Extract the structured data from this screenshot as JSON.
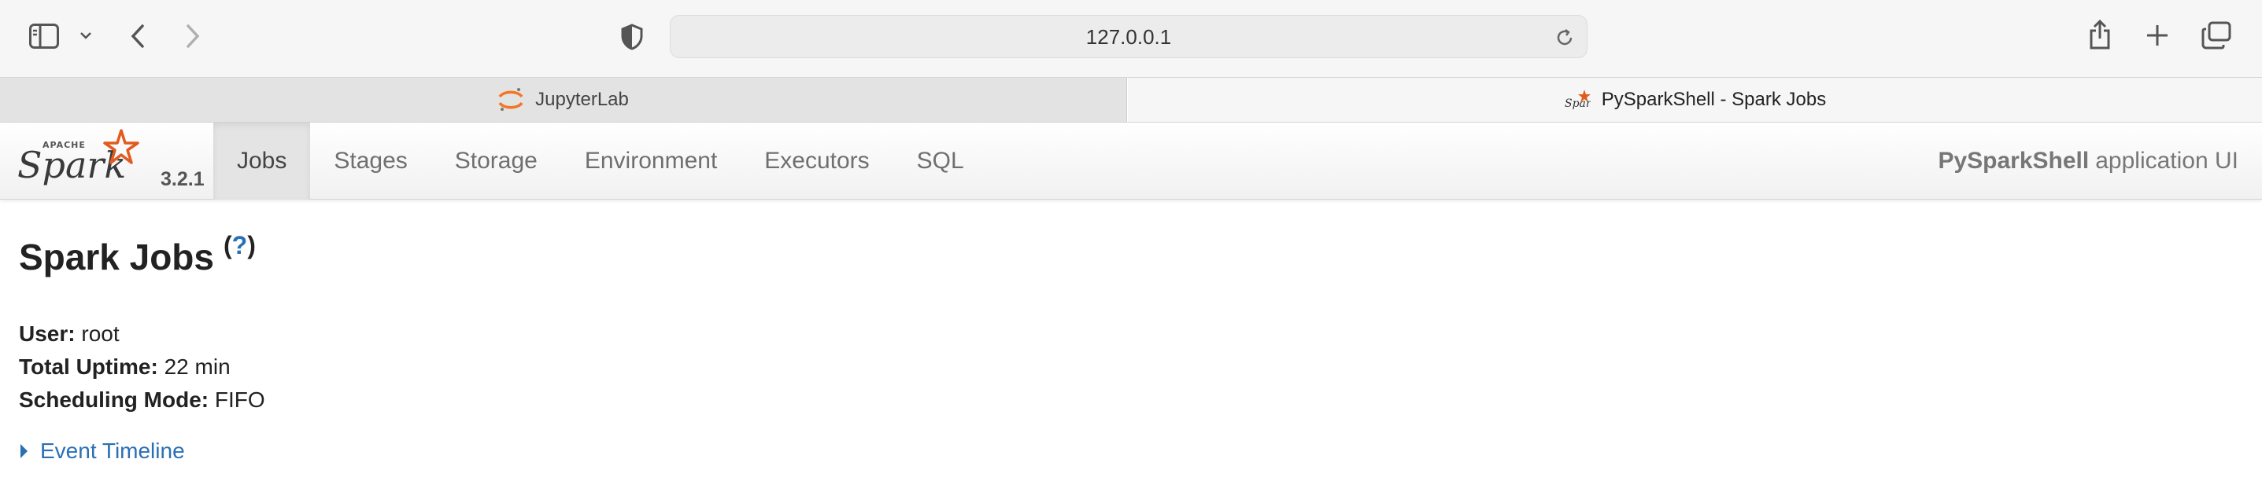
{
  "browser": {
    "url": "127.0.0.1",
    "tabs": [
      {
        "label": "JupyterLab"
      },
      {
        "label": "PySparkShell - Spark Jobs"
      }
    ]
  },
  "spark_ui": {
    "version": "3.2.1",
    "nav": [
      "Jobs",
      "Stages",
      "Storage",
      "Environment",
      "Executors",
      "SQL"
    ],
    "active_nav": "Jobs",
    "app_name": "PySparkShell",
    "app_suffix": "application UI"
  },
  "page": {
    "title": "Spark Jobs",
    "help_open": "(",
    "help_q": "?",
    "help_close": ")",
    "info": [
      {
        "label": "User:",
        "value": "root"
      },
      {
        "label": "Total Uptime:",
        "value": "22 min"
      },
      {
        "label": "Scheduling Mode:",
        "value": "FIFO"
      }
    ],
    "event_timeline": "Event Timeline"
  },
  "colors": {
    "link": "#2a6fb5",
    "spark_orange": "#e25a1c",
    "jupyter_orange": "#f37626"
  }
}
